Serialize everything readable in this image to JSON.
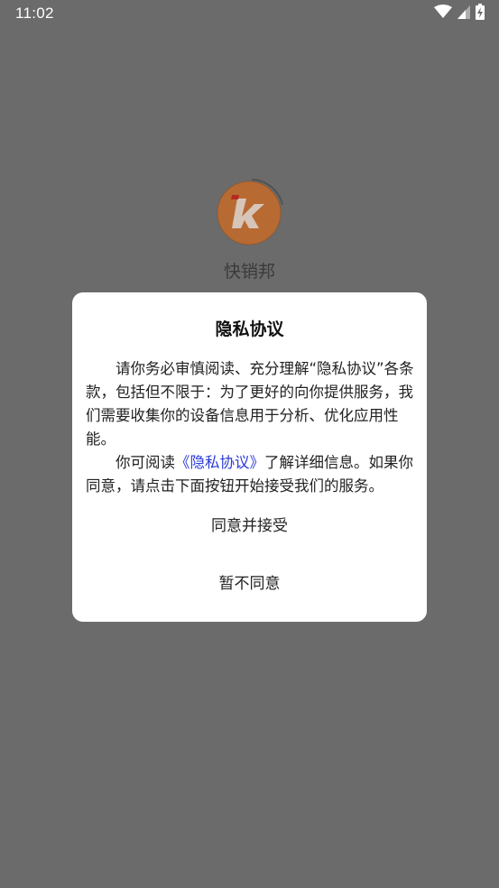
{
  "status_bar": {
    "time": "11:02",
    "icons": [
      "wifi-icon",
      "signal-icon",
      "battery-charging-icon"
    ]
  },
  "splash": {
    "app_name": "快销邦",
    "logo_letter": "k",
    "logo_color": "#c95d12"
  },
  "dialog": {
    "title": "隐私协议",
    "paragraph1": "请你务必审慎阅读、充分理解“隐私协议”各条款，包括但不限于：为了更好的向你提供服务，我们需要收集你的设备信息用于分析、优化应用性能。",
    "paragraph2_prefix": "你可阅读",
    "paragraph2_link": "《隐私协议》",
    "paragraph2_suffix": "了解详细信息。如果你同意，请点击下面按钮开始接受我们的服务。",
    "accept_label": "同意并接受",
    "decline_label": "暂不同意",
    "link_color": "#2b3bd6"
  }
}
